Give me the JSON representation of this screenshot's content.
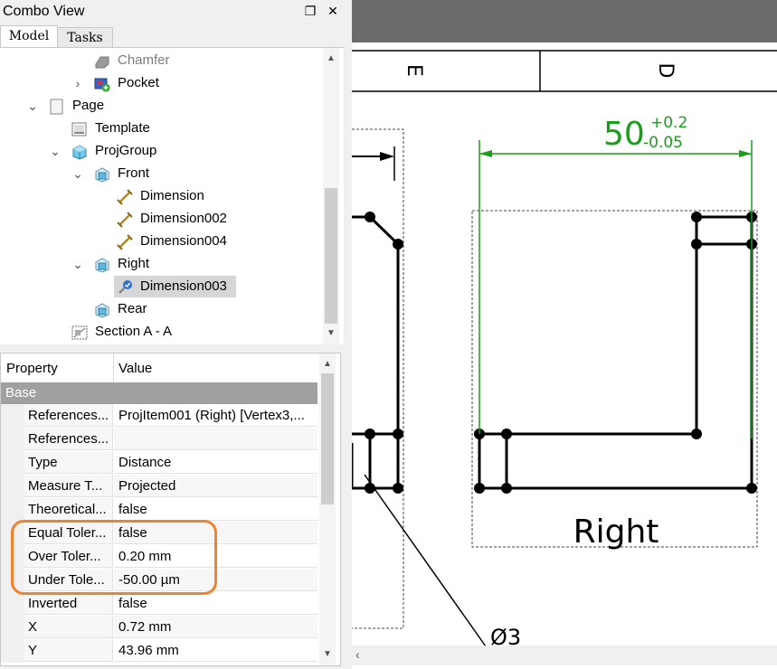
{
  "combo": {
    "title": "Combo View",
    "tabs": [
      {
        "label": "Model"
      },
      {
        "label": "Tasks"
      }
    ]
  },
  "tree": {
    "items": [
      {
        "label": "Chamfer",
        "icon": "chamfer-icon",
        "muted": true
      },
      {
        "label": "Pocket",
        "icon": "pocket-icon"
      },
      {
        "label": "Page",
        "icon": "page-icon"
      },
      {
        "label": "Template",
        "icon": "template-icon"
      },
      {
        "label": "ProjGroup",
        "icon": "projgroup-icon"
      },
      {
        "label": "Front",
        "icon": "projection-icon"
      },
      {
        "label": "Dimension",
        "icon": "dimension-icon"
      },
      {
        "label": "Dimension002",
        "icon": "dimension-icon"
      },
      {
        "label": "Dimension004",
        "icon": "dimension-icon"
      },
      {
        "label": "Right",
        "icon": "projection-icon"
      },
      {
        "label": "Dimension003",
        "icon": "dimension-selected-icon"
      },
      {
        "label": "Rear",
        "icon": "projection-icon"
      },
      {
        "label": "Section A - A",
        "icon": "section-icon"
      }
    ]
  },
  "properties": {
    "header": {
      "property": "Property",
      "value": "Value"
    },
    "group": "Base",
    "rows": [
      {
        "key": "References...",
        "value": "ProjItem001 (Right) [Vertex3,..."
      },
      {
        "key": "References...",
        "value": ""
      },
      {
        "key": "Type",
        "value": "Distance"
      },
      {
        "key": "Measure T...",
        "value": "Projected"
      },
      {
        "key": "Theoretical...",
        "value": "false"
      },
      {
        "key": "Equal Toler...",
        "value": "false"
      },
      {
        "key": "Over Toler...",
        "value": "0.20 mm"
      },
      {
        "key": "Under Tole...",
        "value": "-50.00 µm"
      },
      {
        "key": "Inverted",
        "value": "false"
      },
      {
        "key": "X",
        "value": "0.72 mm"
      },
      {
        "key": "Y",
        "value": "43.96 mm"
      }
    ]
  },
  "drawing": {
    "zone_left": "E",
    "zone_right": "D",
    "dimension_value": "50",
    "tolerance_upper": "+0.2",
    "tolerance_lower": "-0.05",
    "view_label": "Right",
    "symbol_partial": "Ø3",
    "colors": {
      "dimension": "#1a9e1a",
      "highlight": "#f08331"
    }
  }
}
